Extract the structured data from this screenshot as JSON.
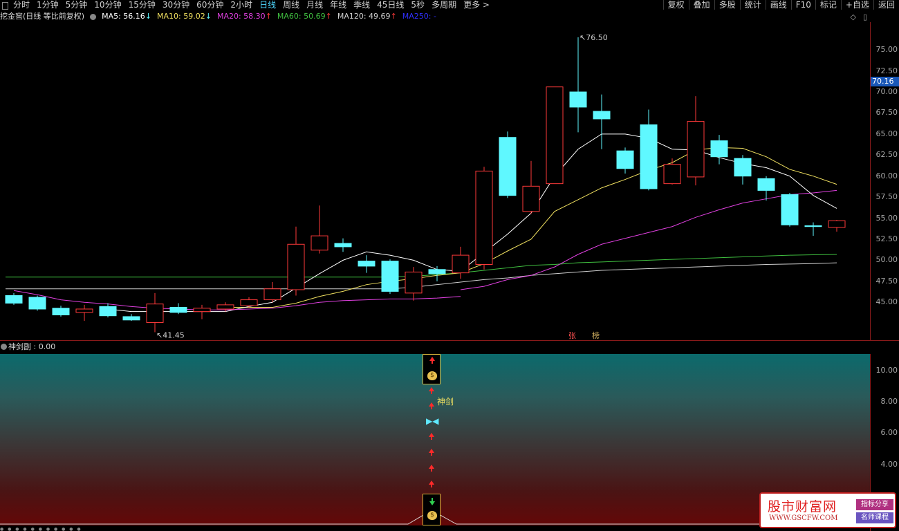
{
  "toolbar": {
    "left_items": [
      "分时",
      "1分钟",
      "5分钟",
      "10分钟",
      "15分钟",
      "30分钟",
      "60分钟",
      "2小时",
      "日线",
      "周线",
      "月线",
      "年线",
      "季线",
      "45日线",
      "5秒",
      "多周期",
      "更多 >"
    ],
    "active_item": "日线",
    "right_items": [
      "复权",
      "叠加",
      "多股",
      "统计",
      "画线",
      "F10",
      "标记",
      "+自选",
      "返回"
    ]
  },
  "legend": {
    "stock": "挖金窖(日线 等比前复权)",
    "ma5": "MA5: 56.16",
    "ma5_arrow": "↓",
    "ma10": "MA10: 59.02",
    "ma10_arrow": "↓",
    "ma20": "MA20: 58.30",
    "ma20_arrow": "↑",
    "ma60": "MA60: 50.69",
    "ma60_arrow": "↑",
    "ma120": "MA120: 49.69",
    "ma120_arrow": "↑",
    "ma250": "MA250: -"
  },
  "colors": {
    "ma5": "#ffffff",
    "ma10": "#f0e060",
    "ma20": "#e040e0",
    "ma60": "#40c040",
    "ma120": "#d0d0d0",
    "ma250": "#3030ff",
    "up_candle": "#ff3a3a",
    "down_candle": "#5ff8ff"
  },
  "current_price": "70.16",
  "price_axis": [
    "75.00",
    "72.50",
    "70.00",
    "67.50",
    "65.00",
    "62.50",
    "60.00",
    "57.50",
    "55.00",
    "52.50",
    "50.00",
    "47.50",
    "45.00"
  ],
  "chart_data": {
    "type": "candlestick",
    "candles": [
      {
        "o": 45.8,
        "c": 44.9,
        "h": 46.1,
        "l": 44.7
      },
      {
        "o": 45.6,
        "c": 44.2,
        "h": 45.8,
        "l": 44.0
      },
      {
        "o": 44.3,
        "c": 43.5,
        "h": 44.6,
        "l": 43.3
      },
      {
        "o": 43.8,
        "c": 44.2,
        "h": 44.7,
        "l": 42.8
      },
      {
        "o": 44.5,
        "c": 43.4,
        "h": 44.9,
        "l": 43.2
      },
      {
        "o": 43.3,
        "c": 42.9,
        "h": 43.6,
        "l": 42.8
      },
      {
        "o": 42.6,
        "c": 44.8,
        "h": 46.1,
        "l": 41.45
      },
      {
        "o": 44.4,
        "c": 43.8,
        "h": 44.9,
        "l": 43.6
      },
      {
        "o": 43.9,
        "c": 44.3,
        "h": 44.7,
        "l": 43.0
      },
      {
        "o": 44.2,
        "c": 44.7,
        "h": 45.0,
        "l": 43.9
      },
      {
        "o": 44.6,
        "c": 45.3,
        "h": 45.6,
        "l": 44.4
      },
      {
        "o": 45.3,
        "c": 46.6,
        "h": 47.4,
        "l": 45.0
      },
      {
        "o": 46.5,
        "c": 51.9,
        "h": 54.0,
        "l": 45.8
      },
      {
        "o": 51.2,
        "c": 52.9,
        "h": 56.5,
        "l": 50.8
      },
      {
        "o": 52.0,
        "c": 51.6,
        "h": 52.6,
        "l": 51.0
      },
      {
        "o": 49.9,
        "c": 49.3,
        "h": 50.6,
        "l": 48.5
      },
      {
        "o": 49.9,
        "c": 46.3,
        "h": 50.1,
        "l": 46.0
      },
      {
        "o": 46.1,
        "c": 48.6,
        "h": 49.2,
        "l": 45.2
      },
      {
        "o": 48.9,
        "c": 48.4,
        "h": 49.3,
        "l": 47.5
      },
      {
        "o": 48.5,
        "c": 50.6,
        "h": 51.6,
        "l": 47.8
      },
      {
        "o": 49.5,
        "c": 60.6,
        "h": 61.1,
        "l": 48.9
      },
      {
        "o": 64.6,
        "c": 57.7,
        "h": 65.3,
        "l": 57.4
      },
      {
        "o": 55.8,
        "c": 58.8,
        "h": 61.8,
        "l": 55.5
      },
      {
        "o": 59.1,
        "c": 70.6,
        "h": 70.6,
        "l": 59.1
      },
      {
        "o": 70.0,
        "c": 68.2,
        "h": 76.5,
        "l": 65.2
      },
      {
        "o": 67.7,
        "c": 66.8,
        "h": 69.7,
        "l": 63.2
      },
      {
        "o": 63.0,
        "c": 60.9,
        "h": 63.4,
        "l": 60.3
      },
      {
        "o": 66.1,
        "c": 58.5,
        "h": 67.9,
        "l": 58.3
      },
      {
        "o": 59.1,
        "c": 61.4,
        "h": 62.1,
        "l": 59.0
      },
      {
        "o": 59.9,
        "c": 66.5,
        "h": 69.5,
        "l": 58.9
      },
      {
        "o": 64.2,
        "c": 62.3,
        "h": 64.9,
        "l": 61.4
      },
      {
        "o": 62.1,
        "c": 60.0,
        "h": 62.5,
        "l": 59.0
      },
      {
        "o": 59.7,
        "c": 58.3,
        "h": 60.0,
        "l": 57.1
      },
      {
        "o": 57.8,
        "c": 54.2,
        "h": 58.0,
        "l": 54.0
      },
      {
        "o": 54.1,
        "c": 54.0,
        "h": 54.5,
        "l": 52.9
      },
      {
        "o": 53.9,
        "c": 54.7,
        "h": 54.8,
        "l": 53.4
      }
    ],
    "ma": {
      "ma5": [
        null,
        null,
        null,
        null,
        44.2,
        43.9,
        43.9,
        43.9,
        43.9,
        43.9,
        44.5,
        45.0,
        46.7,
        48.4,
        50.0,
        51.0,
        50.6,
        50.0,
        48.9,
        48.7,
        50.9,
        53.1,
        55.6,
        60.0,
        63.2,
        65.0,
        65.0,
        64.5,
        63.2,
        63.1,
        62.2,
        61.5,
        61.0,
        60.0,
        57.7,
        56.16
      ],
      "ma10": [
        null,
        null,
        null,
        null,
        null,
        null,
        null,
        null,
        null,
        44.4,
        44.4,
        44.4,
        44.9,
        45.7,
        46.3,
        47.1,
        47.5,
        47.8,
        48.2,
        48.5,
        49.6,
        51.1,
        52.5,
        55.8,
        57.2,
        58.6,
        59.6,
        60.7,
        61.6,
        63.1,
        63.4,
        63.3,
        62.3,
        60.8,
        60.0,
        59.02
      ],
      "ma20": [
        null,
        null,
        null,
        null,
        null,
        null,
        null,
        null,
        null,
        null,
        null,
        null,
        null,
        null,
        null,
        null,
        null,
        null,
        null,
        46.5,
        46.9,
        47.7,
        48.2,
        49.2,
        50.7,
        51.9,
        52.6,
        53.3,
        54.0,
        55.1,
        56.0,
        56.8,
        57.3,
        57.8,
        58.0,
        58.3
      ],
      "ma60": [
        48.0,
        48.0,
        48.0,
        48.0,
        48.0,
        48.0,
        48.0,
        48.0,
        48.0,
        48.0,
        48.0,
        48.0,
        48.0,
        48.0,
        48.0,
        48.0,
        48.0,
        48.1,
        48.3,
        48.5,
        48.8,
        49.1,
        49.4,
        49.5,
        49.7,
        49.8,
        49.9,
        50.0,
        50.1,
        50.2,
        50.3,
        50.4,
        50.5,
        50.6,
        50.65,
        50.69
      ],
      "ma120": [
        46.6,
        46.6,
        46.6,
        46.6,
        46.6,
        46.6,
        46.6,
        46.6,
        46.6,
        46.6,
        46.6,
        46.6,
        46.6,
        46.6,
        46.6,
        46.6,
        46.6,
        46.8,
        47.1,
        47.4,
        47.7,
        47.9,
        48.2,
        48.4,
        48.6,
        48.8,
        48.9,
        49.0,
        49.1,
        49.2,
        49.3,
        49.4,
        49.5,
        49.55,
        49.6,
        49.69
      ],
      "ma_alt": [
        46.4,
        45.9,
        45.3,
        45.0,
        44.8,
        44.5,
        44.3,
        44.2,
        44.1,
        44.1,
        44.2,
        44.3,
        44.6,
        45.0,
        45.2,
        45.3,
        45.4,
        45.4,
        45.5,
        45.7
      ]
    },
    "annotations": {
      "high_label": "76.50",
      "low_label": "41.45"
    },
    "ylim": [
      40.5,
      78.3
    ]
  },
  "markers": {
    "zhang": "张",
    "bang": "榜"
  },
  "sub": {
    "title": "神剑副 : 0.00",
    "axis": [
      "10.00",
      "8.00",
      "6.00",
      "4.00"
    ],
    "label": "神剑",
    "bag_icon": "money-bag-icon",
    "butterfly": "butterfly-icon"
  },
  "watermark": {
    "name": "股市财富网",
    "url": "WWW.GSCFW.COM",
    "tag1": "指标分享",
    "tag2": "名师课程"
  }
}
